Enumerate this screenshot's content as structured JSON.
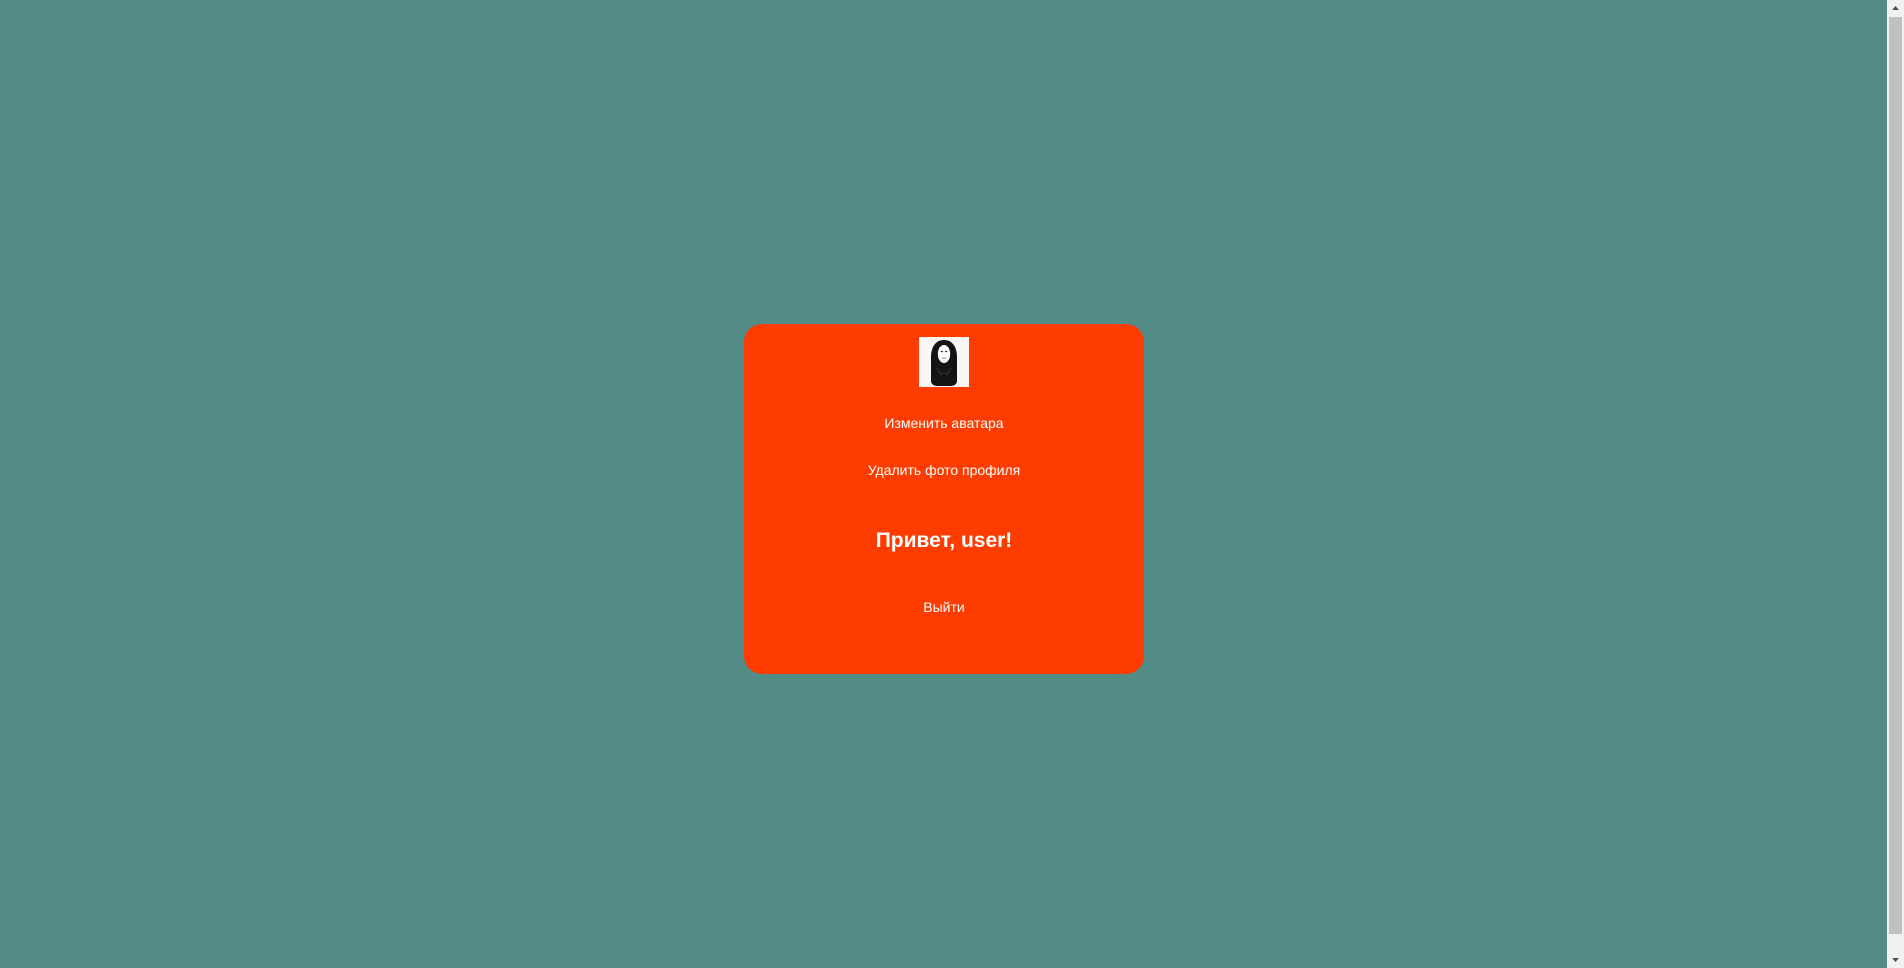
{
  "profile": {
    "avatar": {
      "icon": "no-face-avatar-image"
    },
    "change_avatar_label": "Изменить аватара",
    "delete_photo_label": "Удалить фото профиля",
    "greeting": "Привет, user!",
    "logout_label": "Выйти"
  },
  "theme": {
    "page_background": "#538b86",
    "card_background": "#ff3c00",
    "text_color": "#ffffff"
  },
  "scrollbar": {
    "up_icon": "scroll-up-arrow-icon",
    "down_icon": "scroll-down-arrow-icon"
  }
}
